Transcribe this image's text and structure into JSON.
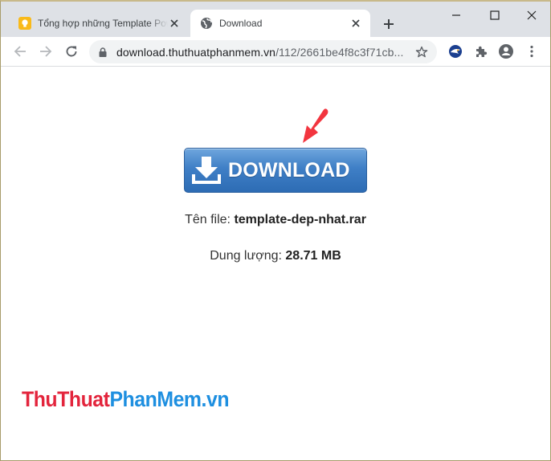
{
  "browser": {
    "tabs": [
      {
        "title": "Tổng hợp những Template PowerPoint",
        "favicon": "lightbulb-icon",
        "active": false
      },
      {
        "title": "Download",
        "favicon": "globe-icon",
        "active": true
      }
    ],
    "new_tab_label": "+",
    "url": {
      "host": "download.thuthuatphanmem.vn",
      "path": "/112/2661be4f8c3f71cb..."
    }
  },
  "page": {
    "download_button_label": "DOWNLOAD",
    "file_name_label": "Tên file:",
    "file_name": "template-dep-nhat.rar",
    "size_label": "Dung lượng:",
    "size": "28.71 MB"
  },
  "watermark": {
    "part1": "ThuThuat",
    "part2": "PhanMem.vn",
    "colors": {
      "part1": "#e3243c",
      "part2": "#1e8fe0"
    }
  },
  "colors": {
    "tabstrip": "#dee1e6",
    "button_blue": "#3f7fc6",
    "arrow_red": "#f2353f"
  }
}
